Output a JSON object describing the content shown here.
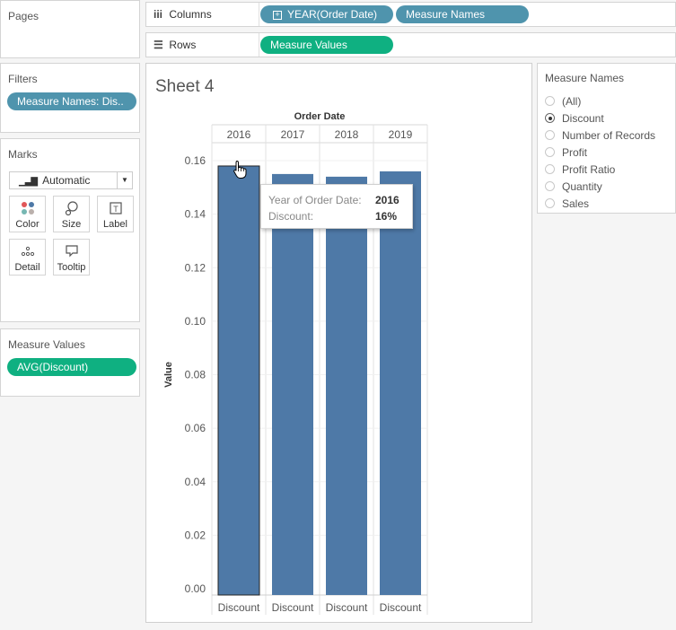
{
  "pages": {
    "title": "Pages"
  },
  "columns_shelf": {
    "label": "Columns",
    "pills": [
      {
        "text": "YEAR(Order Date)",
        "expand_icon": "plus-box-icon"
      },
      {
        "text": "Measure Names"
      }
    ]
  },
  "rows_shelf": {
    "label": "Rows",
    "pills": [
      {
        "text": "Measure Values"
      }
    ]
  },
  "filters": {
    "title": "Filters",
    "pills": [
      {
        "text": "Measure Names: Dis.."
      }
    ]
  },
  "marks": {
    "title": "Marks",
    "mark_type": "Automatic",
    "buttons": [
      {
        "label": "Color",
        "icon": "color-dots-icon"
      },
      {
        "label": "Size",
        "icon": "size-icon"
      },
      {
        "label": "Label",
        "icon": "label-icon"
      },
      {
        "label": "Detail",
        "icon": "detail-icon"
      },
      {
        "label": "Tooltip",
        "icon": "tooltip-icon"
      }
    ]
  },
  "measure_values": {
    "title": "Measure Values",
    "pills": [
      {
        "text": "AVG(Discount)"
      }
    ]
  },
  "sheet": {
    "title": "Sheet 4"
  },
  "legend": {
    "title": "Measure Names",
    "items": [
      {
        "label": "(All)",
        "selected": false
      },
      {
        "label": "Discount",
        "selected": true
      },
      {
        "label": "Number of Records",
        "selected": false
      },
      {
        "label": "Profit",
        "selected": false
      },
      {
        "label": "Profit Ratio",
        "selected": false
      },
      {
        "label": "Quantity",
        "selected": false
      },
      {
        "label": "Sales",
        "selected": false
      }
    ]
  },
  "tooltip": {
    "rows": [
      {
        "key": "Year of Order Date:",
        "value": "2016"
      },
      {
        "key": "Discount:",
        "value": "16%"
      }
    ]
  },
  "colors": {
    "bar": "#4e79a7",
    "pill_blue": "#4f94ad",
    "pill_green": "#0fb081"
  },
  "chart_data": {
    "type": "bar",
    "header_title": "Order Date",
    "categories": [
      "2016",
      "2017",
      "2018",
      "2019"
    ],
    "sub_category": "Discount",
    "values": [
      0.158,
      0.155,
      0.154,
      0.156
    ],
    "ylabel": "Value",
    "ylim": [
      0,
      0.16
    ],
    "yticks": [
      "0.00",
      "0.02",
      "0.04",
      "0.06",
      "0.08",
      "0.10",
      "0.12",
      "0.14",
      "0.16"
    ],
    "grid": true
  }
}
